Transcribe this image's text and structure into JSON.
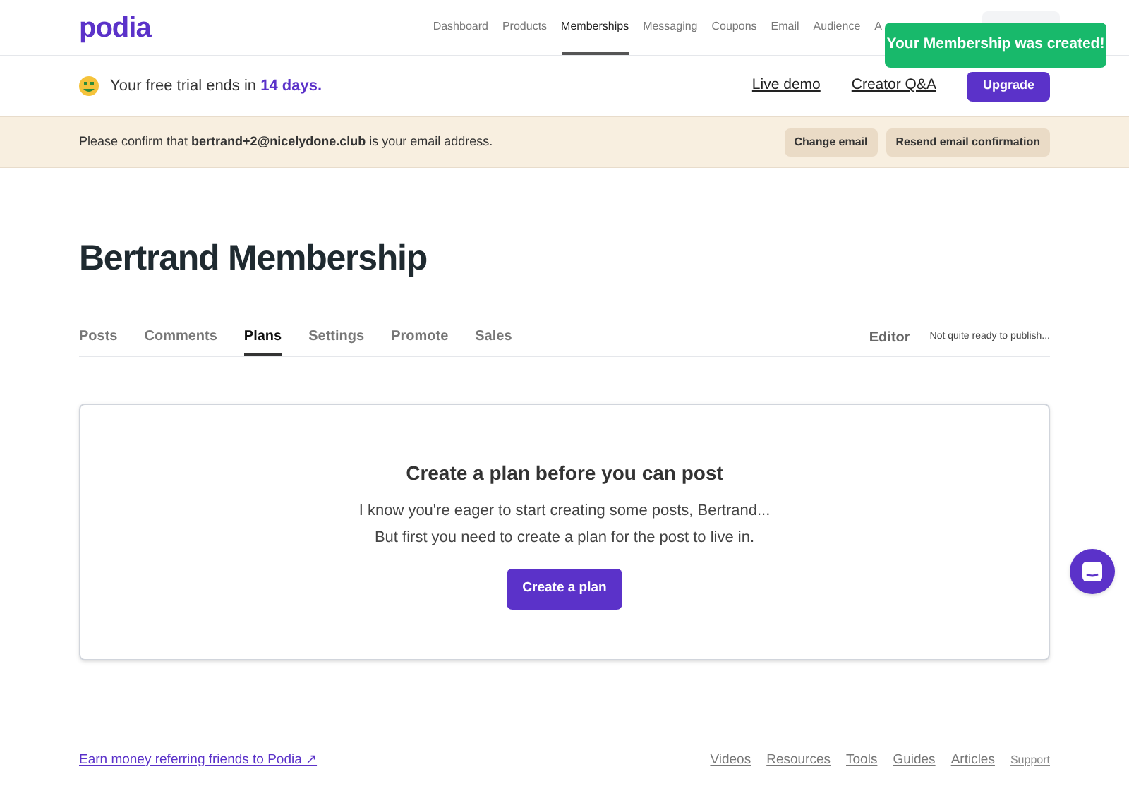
{
  "logo": "podia",
  "nav": [
    {
      "label": "Dashboard",
      "selected": false
    },
    {
      "label": "Products",
      "selected": false
    },
    {
      "label": "Memberships",
      "selected": true
    },
    {
      "label": "Messaging",
      "selected": false
    },
    {
      "label": "Coupons",
      "selected": false
    },
    {
      "label": "Email",
      "selected": false
    },
    {
      "label": "Audience",
      "selected": false
    },
    {
      "label": "A",
      "selected": false
    }
  ],
  "toast": "Your Membership was created!",
  "trial": {
    "text": "Your free trial ends in **14 days.**",
    "links": [
      "Live demo",
      "Creator Q&A"
    ],
    "button": "Upgrade"
  },
  "email_notice": {
    "text": "Please confirm that **bertrand+2@nicelydone.club** is your email address.",
    "buttons": [
      "Change email",
      "Resend email confirmation"
    ]
  },
  "title": "Bertrand Membership",
  "tabs": [
    {
      "label": "Posts",
      "selected": false
    },
    {
      "label": "Comments",
      "selected": false
    },
    {
      "label": "Plans",
      "selected": true
    },
    {
      "label": "Settings",
      "selected": false
    },
    {
      "label": "Promote",
      "selected": false
    },
    {
      "label": "Sales",
      "selected": false
    }
  ],
  "editor_link": "Editor",
  "publish_status": "Not quite ready to publish...",
  "empty_state": {
    "heading": "Create a plan before you can post",
    "lines": [
      "I know you're eager to start creating some posts, Bertrand...",
      "But first you need to create a plan for the post to live in."
    ],
    "button": "Create a plan"
  },
  "footer": {
    "referral": "Earn money referring friends to Podia ↗",
    "links": [
      "Videos",
      "Resources",
      "Tools",
      "Guides",
      "Articles"
    ],
    "support": "Support"
  }
}
